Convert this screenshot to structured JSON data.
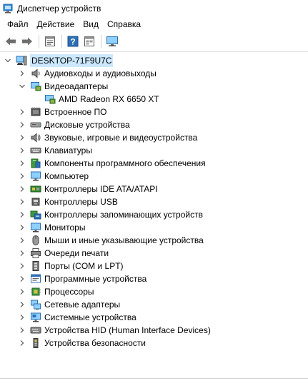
{
  "window": {
    "title": "Диспетчер устройств"
  },
  "menu": [
    "Файл",
    "Действие",
    "Вид",
    "Справка"
  ],
  "toolbar": [
    {
      "name": "back-button",
      "icon": "arrow-left-icon"
    },
    {
      "name": "forward-button",
      "icon": "arrow-right-icon"
    },
    {
      "name": "properties-button",
      "icon": "properties-icon"
    },
    {
      "name": "help-button",
      "icon": "help-icon"
    },
    {
      "name": "view-button",
      "icon": "view-icon"
    },
    {
      "name": "scan-hardware-button",
      "icon": "monitor-icon"
    }
  ],
  "tree": {
    "root": {
      "label": "DESKTOP-71F9U7C",
      "icon": "computer-icon",
      "expanded": true
    },
    "categories": [
      {
        "label": "Аудиовходы и аудиовыходы",
        "icon": "speaker-icon",
        "expanded": false
      },
      {
        "label": "Видеоадаптеры",
        "icon": "display-adapter-icon",
        "expanded": true,
        "children": [
          {
            "label": "AMD Radeon RX 6650 XT",
            "icon": "display-adapter-icon"
          }
        ]
      },
      {
        "label": "Встроенное ПО",
        "icon": "firmware-icon",
        "expanded": false
      },
      {
        "label": "Дисковые устройства",
        "icon": "disk-drive-icon",
        "expanded": false
      },
      {
        "label": "Звуковые, игровые и видеоустройства",
        "icon": "sound-icon",
        "expanded": false
      },
      {
        "label": "Клавиатуры",
        "icon": "keyboard-icon",
        "expanded": false
      },
      {
        "label": "Компоненты программного обеспечения",
        "icon": "software-component-icon",
        "expanded": false
      },
      {
        "label": "Компьютер",
        "icon": "monitor-icon",
        "expanded": false
      },
      {
        "label": "Контроллеры IDE ATA/ATAPI",
        "icon": "ide-controller-icon",
        "expanded": false
      },
      {
        "label": "Контроллеры USB",
        "icon": "usb-icon",
        "expanded": false
      },
      {
        "label": "Контроллеры запоминающих устройств",
        "icon": "storage-controller-icon",
        "expanded": false
      },
      {
        "label": "Мониторы",
        "icon": "monitor-icon",
        "expanded": false
      },
      {
        "label": "Мыши и иные указывающие устройства",
        "icon": "mouse-icon",
        "expanded": false
      },
      {
        "label": "Очереди печати",
        "icon": "printer-icon",
        "expanded": false
      },
      {
        "label": "Порты (COM и LPT)",
        "icon": "port-icon",
        "expanded": false
      },
      {
        "label": "Программные устройства",
        "icon": "software-device-icon",
        "expanded": false
      },
      {
        "label": "Процессоры",
        "icon": "processor-icon",
        "expanded": false
      },
      {
        "label": "Сетевые адаптеры",
        "icon": "network-adapter-icon",
        "expanded": false
      },
      {
        "label": "Системные устройства",
        "icon": "system-device-icon",
        "expanded": false
      },
      {
        "label": "Устройства HID (Human Interface Devices)",
        "icon": "hid-icon",
        "expanded": false
      },
      {
        "label": "Устройства безопасности",
        "icon": "security-device-icon",
        "expanded": false
      }
    ]
  },
  "colors": {
    "selection": "#cce8ff",
    "accent": "#2f7fd0",
    "chevron": "#555555"
  }
}
